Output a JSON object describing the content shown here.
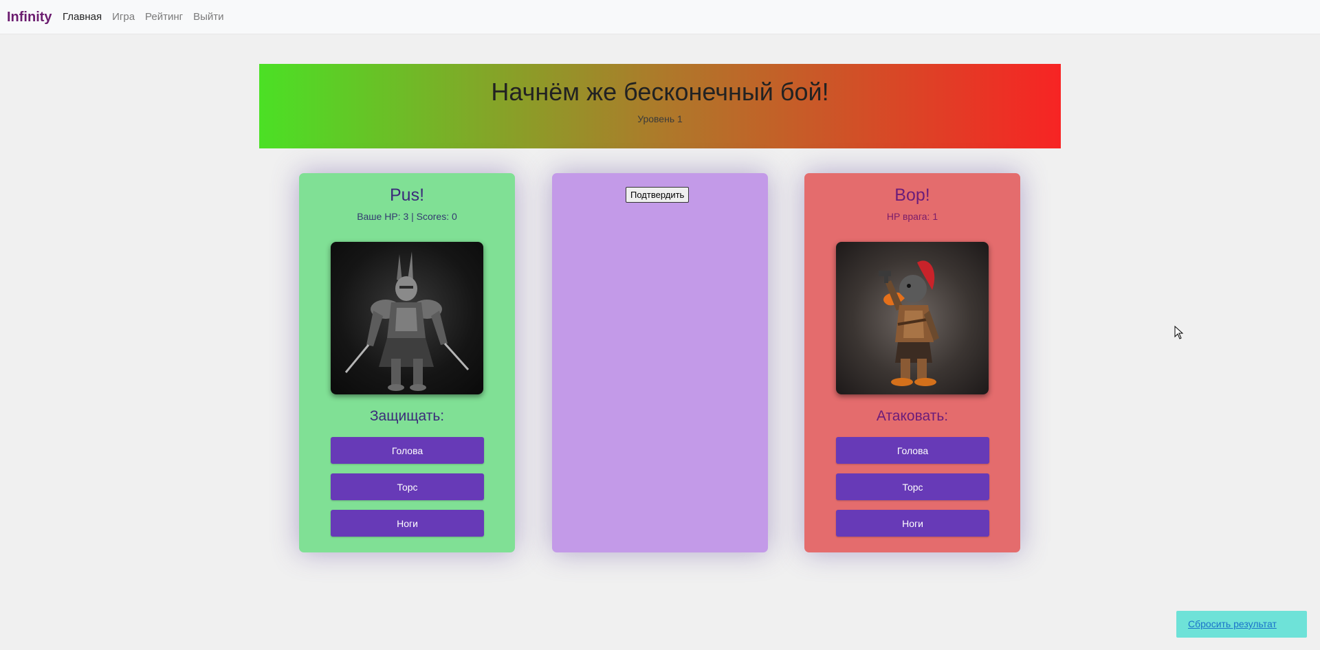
{
  "navbar": {
    "brand": "Infinity",
    "links": [
      {
        "label": "Главная",
        "active": true
      },
      {
        "label": "Игра",
        "active": false
      },
      {
        "label": "Рейтинг",
        "active": false
      },
      {
        "label": "Выйти",
        "active": false
      }
    ]
  },
  "banner": {
    "title": "Начнём же бесконечный бой!",
    "level": "Уровень 1",
    "gradient_colors": [
      "#4be025",
      "#ad7a2a",
      "#f72424"
    ]
  },
  "player": {
    "name": "Pus!",
    "stats": "Ваше HP: 3 | Scores: 0",
    "portrait_icon": "armored-knight-portrait",
    "action_label": "Защищать:",
    "buttons": [
      "Голова",
      "Торс",
      "Ноги"
    ],
    "card_color": "#80e095"
  },
  "middle": {
    "confirm_label": "Подтвердить",
    "card_color": "#c39ae8"
  },
  "enemy": {
    "name": "Вор!",
    "stats": "HP врага: 1",
    "portrait_icon": "duck-thief-portrait",
    "action_label": "Атаковать:",
    "buttons": [
      "Голова",
      "Торс",
      "Ноги"
    ],
    "card_color": "#e46c6d"
  },
  "reset": {
    "label": "Сбросить результат"
  },
  "colors": {
    "accent": "#673ab7",
    "brand": "#6b1c6f",
    "reset_bg": "#6ee2d8"
  }
}
